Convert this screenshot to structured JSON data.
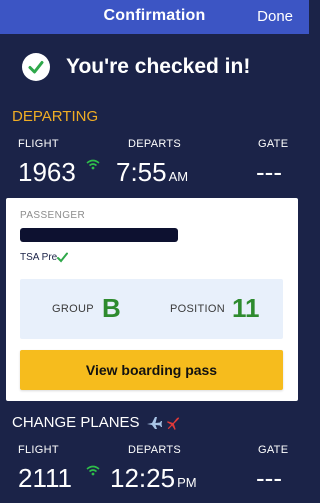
{
  "nav": {
    "title": "Confirmation",
    "done_label": "Done"
  },
  "banner": {
    "text": "You're checked in!"
  },
  "departing": {
    "title": "DEPARTING",
    "flight_label": "FLIGHT",
    "flight_value": "1963",
    "departs_label": "DEPARTS",
    "departs_time": "7:55",
    "departs_ampm": "AM",
    "gate_label": "GATE",
    "gate_value": "---"
  },
  "passenger": {
    "label": "PASSENGER",
    "tsa_text": "TSA Pre",
    "group_label": "GROUP",
    "group_value": "B",
    "position_label": "POSITION",
    "position_value": "11",
    "button_label": "View boarding pass"
  },
  "change": {
    "title": "CHANGE PLANES",
    "flight_label": "FLIGHT",
    "flight_value": "2111",
    "departs_label": "DEPARTS",
    "departs_time": "12:25",
    "departs_ampm": "PM",
    "gate_label": "GATE",
    "gate_value": "---"
  },
  "colors": {
    "background": "#1b2348",
    "navbar": "#3c55c4",
    "accent_orange": "#f0ad24",
    "wifi_green": "#2fbf4a",
    "group_green": "#2e8b2e",
    "button_yellow": "#f6bc1d",
    "plane_red": "#e03a3a"
  },
  "icons": [
    "check-icon",
    "wifi-icon",
    "tsa-check-icon",
    "airplane-icon",
    "airplane-red-icon"
  ]
}
